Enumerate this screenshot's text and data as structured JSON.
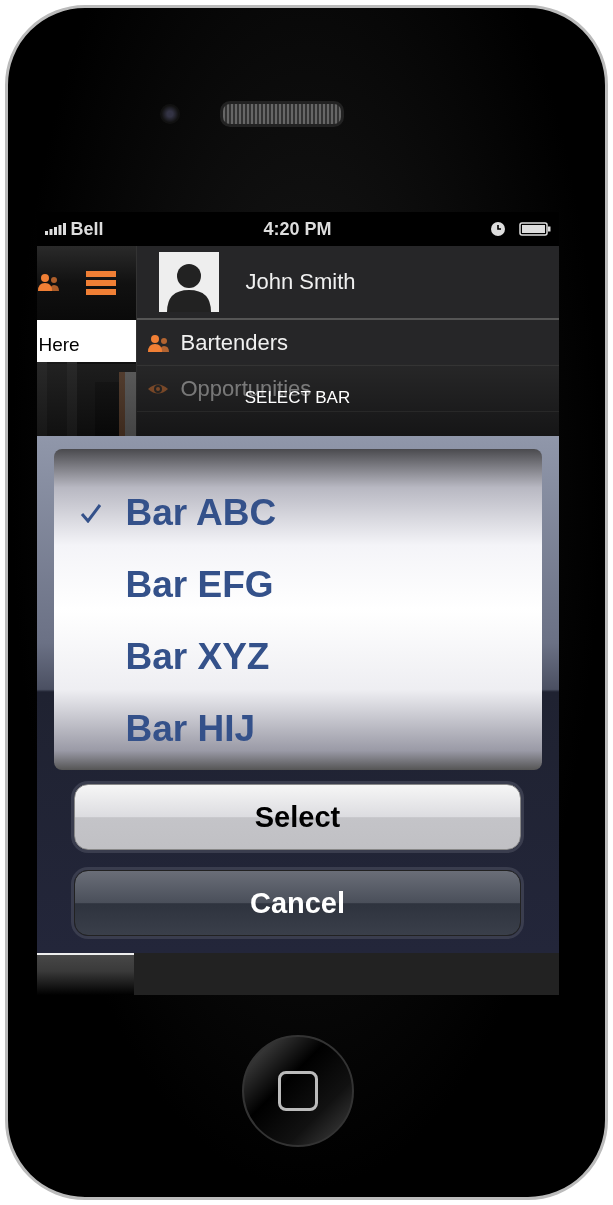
{
  "status_bar": {
    "carrier": "Bell",
    "time": "4:20 PM"
  },
  "side_panel": {
    "search_field": {
      "value": "Here"
    }
  },
  "menu": {
    "user_name": "John Smith",
    "items": [
      {
        "label": "Bartenders"
      },
      {
        "label": "Opportunities"
      }
    ]
  },
  "sheet": {
    "title": "SELECT BAR",
    "options": [
      {
        "label": "Bar ABC",
        "selected": true
      },
      {
        "label": "Bar EFG",
        "selected": false
      },
      {
        "label": "Bar XYZ",
        "selected": false
      },
      {
        "label": "Bar HIJ",
        "selected": false
      }
    ],
    "buttons": [
      {
        "label": "Select",
        "kind": "primary"
      },
      {
        "label": "Cancel",
        "kind": "secondary"
      }
    ]
  }
}
